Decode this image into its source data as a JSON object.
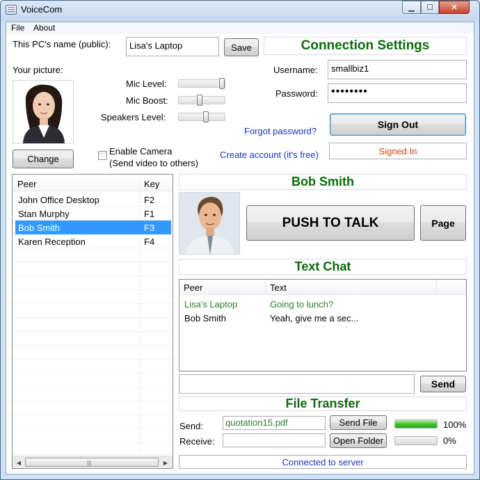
{
  "window": {
    "title": "VoiceCom",
    "icon": "app-icon"
  },
  "menu": {
    "items": [
      "File",
      "About"
    ]
  },
  "pc_name": {
    "label": "This PC's name (public):",
    "value": "Lisa's Laptop",
    "save_label": "Save"
  },
  "picture": {
    "label": "Your picture:",
    "change_label": "Change"
  },
  "audio": {
    "mic_level": {
      "label": "Mic Level:",
      "value": 1.0
    },
    "mic_boost": {
      "label": "Mic Boost:",
      "value": 0.45
    },
    "speakers_level": {
      "label": "Speakers Level:",
      "value": 0.6
    }
  },
  "camera": {
    "label": "Enable Camera",
    "sublabel": "(Send video to others)",
    "checked": false
  },
  "connection": {
    "title": "Connection Settings",
    "username_label": "Username:",
    "username_value": "smallbiz1",
    "password_label": "Password:",
    "password_value": "••••••••",
    "forgot_link": "Forgot password?",
    "create_link": "Create account (it's free)",
    "sign_out_label": "Sign Out",
    "status": "Signed In",
    "status_color": "#d83b01"
  },
  "peers": {
    "columns": [
      "Peer",
      "Key"
    ],
    "rows": [
      {
        "name": "John Office Desktop",
        "key": "F2"
      },
      {
        "name": "Stan Murphy",
        "key": "F1"
      },
      {
        "name": "Bob Smith",
        "key": "F3"
      },
      {
        "name": "Karen Reception",
        "key": "F4"
      }
    ],
    "selected_index": 2,
    "selection_color": "#3399ff"
  },
  "talk": {
    "peer_name": "Bob Smith",
    "push_label": "PUSH TO TALK",
    "page_label": "Page"
  },
  "chat": {
    "title": "Text Chat",
    "columns": [
      "Peer",
      "Text"
    ],
    "messages": [
      {
        "peer": "Lisa's Laptop",
        "text": "Going to lunch?",
        "color": "#2d7d2d"
      },
      {
        "peer": "Bob Smith",
        "text": "Yeah, give me a sec...",
        "color": "#000000"
      }
    ],
    "input_value": "",
    "send_label": "Send"
  },
  "file_transfer": {
    "title": "File Transfer",
    "send_label": "Send:",
    "send_file_value": "quotation15.pdf",
    "send_file_button": "Send File",
    "send_progress": 1.0,
    "send_percent": "100%",
    "receive_label": "Receive:",
    "receive_value": "",
    "open_folder_button": "Open Folder",
    "receive_progress": 0.0,
    "receive_percent": "0%"
  },
  "status_bar": {
    "text": "Connected to server"
  },
  "colors": {
    "accent_green": "#0b6a0b",
    "link_blue": "#1a34b0"
  }
}
